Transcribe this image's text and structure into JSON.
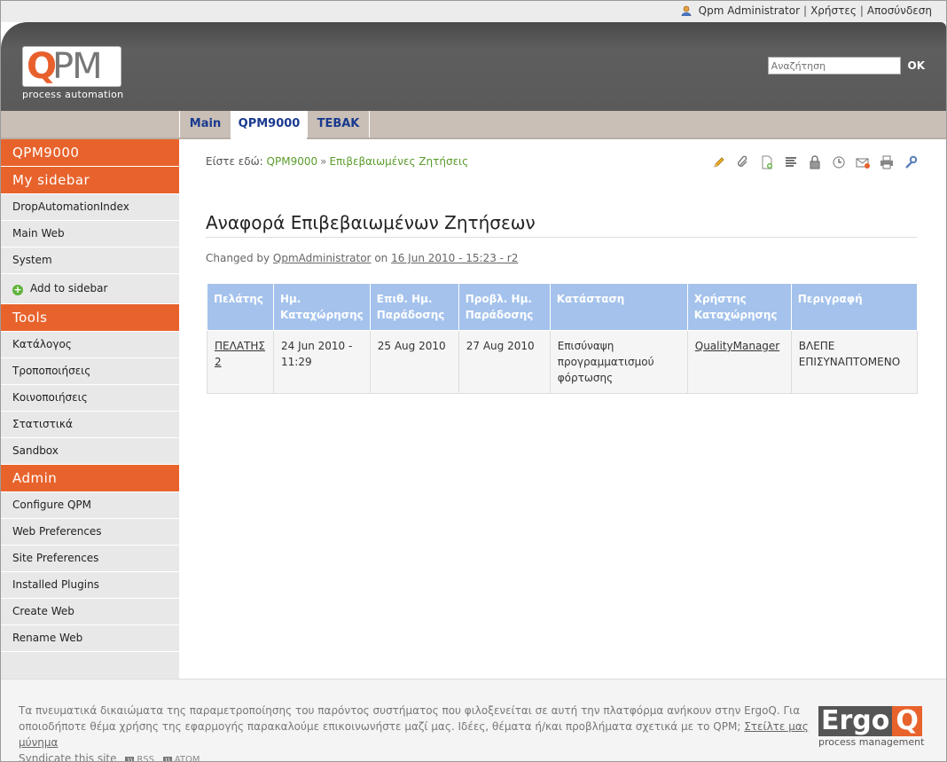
{
  "user": {
    "name": "Qpm Administrator",
    "users_link": "Χρήστες",
    "logout_link": "Αποσύνδεση"
  },
  "logo": {
    "q": "Q",
    "pm": "PM",
    "subtitle": "process automation"
  },
  "search": {
    "placeholder": "Αναζήτηση",
    "ok_label": "OK"
  },
  "tabs": [
    {
      "label": "Main"
    },
    {
      "label": "QPM9000"
    },
    {
      "label": "TEBAK"
    }
  ],
  "sidebar": {
    "web_title": "QPM9000",
    "my_sidebar": {
      "title": "My sidebar",
      "items": [
        "DropAutomationIndex",
        "Main Web",
        "System"
      ],
      "add_label": "Add to sidebar"
    },
    "tools": {
      "title": "Tools",
      "items": [
        "Κατάλογος",
        "Τροποποιήσεις",
        "Κοινοποιήσεις",
        "Στατιστικά",
        "Sandbox"
      ]
    },
    "admin": {
      "title": "Admin",
      "items": [
        "Configure QPM",
        "Web Preferences",
        "Site Preferences",
        "Installed Plugins",
        "Create Web",
        "Rename Web"
      ]
    }
  },
  "breadcrumb": {
    "prefix": "Είστε εδώ:",
    "web": "QPM9000",
    "separator": "»",
    "page": "Επιβεβαιωμένες Ζητήσεις"
  },
  "toolbar_icons": [
    "edit-icon",
    "attach-icon",
    "new-topic-icon",
    "raw-text-icon",
    "lock-icon",
    "history-icon",
    "email-icon",
    "print-icon",
    "settings-icon"
  ],
  "page": {
    "title": "Αναφορά Επιβεβαιωμένων Ζητήσεων",
    "changed_by_prefix": "Changed by",
    "changed_by_user": "QpmAdministrator",
    "changed_on_prefix": "on",
    "changed_on": "16 Jun 2010 - 15:23 - r2"
  },
  "table": {
    "headers": [
      "Πελάτης",
      "Ημ. Καταχώρησης",
      "Επιθ. Ημ. Παράδοσης",
      "Προβλ. Ημ. Παράδοσης",
      "Κατάσταση",
      "Χρήστης Καταχώρησης",
      "Περιγραφή"
    ],
    "rows": [
      [
        "ΠΕΛΑΤΗΣ 2",
        "24 Jun 2010 - 11:29",
        "25 Aug 2010",
        "27 Aug 2010",
        "Επισύναψη προγραμματισμού φόρτωσης",
        "QualityManager",
        "ΒΛΕΠΕ ΕΠΙΣΥΝΑΠΤΟΜΕΝΟ"
      ]
    ]
  },
  "footer": {
    "copyright": "Τα πνευματικά δικαιώματα της παραμετροποίησης του παρόντος συστήματος που φιλοξενείται σε αυτή την πλατφόρμα ανήκουν στην ErgoQ. Για οποιοδήποτε θέμα χρήσης της εφαρμογής παρακαλούμε επικοινωνήστε μαζί μας. Ιδέες, θέματα ή/και προβλήματα σχετικά με το QPM;",
    "contact_link": "Στείλτε μας μύνημα",
    "syndicate": "Syndicate this site",
    "rss": "RSS",
    "atom": "ATOM"
  },
  "ergoq": {
    "word": "Ergo",
    "q": "Q",
    "subtitle": "process management"
  },
  "colors": {
    "accent_orange": "#e8632c",
    "table_header": "#a4c2ec",
    "link_green": "#5a9b2a",
    "tab_text": "#1a3a8f"
  }
}
